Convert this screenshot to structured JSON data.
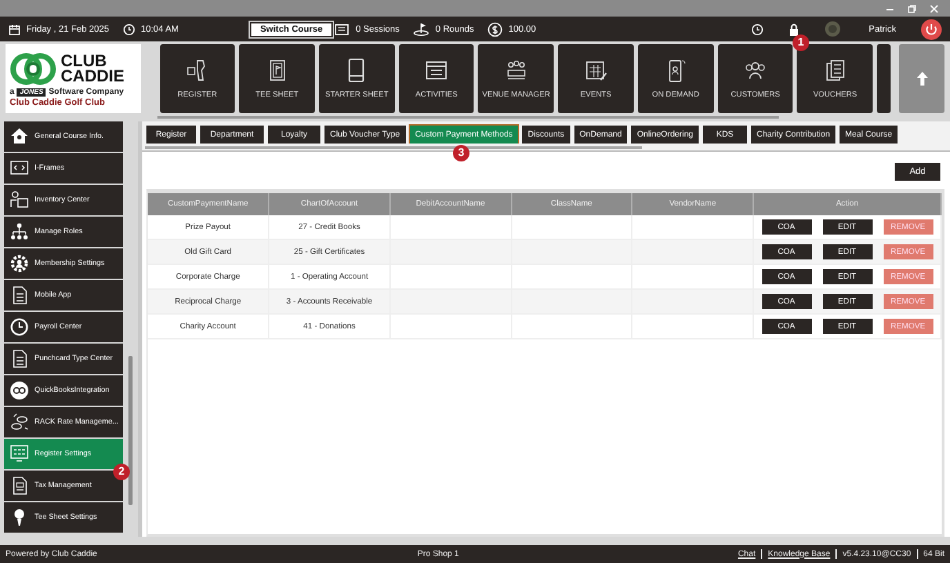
{
  "top_bar": {
    "date": "Friday ,  21 Feb 2025",
    "time": "10:04 AM",
    "switch_course": "Switch Course",
    "sessions": "0 Sessions",
    "rounds": "0 Rounds",
    "balance": "100.00",
    "user": "Patrick"
  },
  "logo": {
    "line1": "CLUB",
    "line2": "CADDIE",
    "prefix": "a",
    "brand": "JONES",
    "rest": "Software Company",
    "club_name": "Club Caddie Golf Club"
  },
  "modules": [
    {
      "label": "REGISTER"
    },
    {
      "label": "TEE SHEET"
    },
    {
      "label": "STARTER SHEET"
    },
    {
      "label": "ACTIVITIES"
    },
    {
      "label": "VENUE MANAGER"
    },
    {
      "label": "EVENTS"
    },
    {
      "label": "ON DEMAND"
    },
    {
      "label": "CUSTOMERS"
    },
    {
      "label": "VOUCHERS"
    }
  ],
  "sidebar": {
    "items": [
      {
        "label": "General Course Info.",
        "selected": false
      },
      {
        "label": "I-Frames",
        "selected": false
      },
      {
        "label": "Inventory Center",
        "selected": false
      },
      {
        "label": "Manage Roles",
        "selected": false
      },
      {
        "label": "Membership Settings",
        "selected": false
      },
      {
        "label": "Mobile App",
        "selected": false
      },
      {
        "label": "Payroll Center",
        "selected": false
      },
      {
        "label": "Punchcard Type Center",
        "selected": false
      },
      {
        "label": "QuickBooksIntegration",
        "selected": false
      },
      {
        "label": "RACK Rate Manageme...",
        "selected": false
      },
      {
        "label": "Register Settings",
        "selected": true
      },
      {
        "label": "Tax Management",
        "selected": false
      },
      {
        "label": "Tee Sheet Settings",
        "selected": false
      }
    ]
  },
  "tabs": [
    {
      "label": "Register",
      "selected": false
    },
    {
      "label": "Department",
      "selected": false
    },
    {
      "label": "Loyalty",
      "selected": false
    },
    {
      "label": "Club Voucher Type",
      "selected": false
    },
    {
      "label": "Custom Payment Methods",
      "selected": true
    },
    {
      "label": "Discounts",
      "selected": false
    },
    {
      "label": "OnDemand",
      "selected": false
    },
    {
      "label": "OnlineOrdering",
      "selected": false
    },
    {
      "label": "KDS",
      "selected": false
    },
    {
      "label": "Charity Contribution",
      "selected": false
    },
    {
      "label": "Meal Course",
      "selected": false
    }
  ],
  "add_button": "Add",
  "table": {
    "columns": [
      "CustomPaymentName",
      "ChartOfAccount",
      "DebitAccountName",
      "ClassName",
      "VendorName",
      "Action"
    ],
    "rows": [
      {
        "cells": [
          "Prize Payout",
          "27 - Credit Books",
          "",
          "",
          ""
        ],
        "actions": [
          "COA",
          "EDIT",
          "REMOVE"
        ]
      },
      {
        "cells": [
          "Old Gift Card",
          "25 - Gift Certificates",
          "",
          "",
          ""
        ],
        "actions": [
          "COA",
          "EDIT",
          "REMOVE"
        ]
      },
      {
        "cells": [
          "Corporate Charge",
          "1 - Operating Account",
          "",
          "",
          ""
        ],
        "actions": [
          "COA",
          "EDIT",
          "REMOVE"
        ]
      },
      {
        "cells": [
          "Reciprocal Charge",
          "3 - Accounts Receivable",
          "",
          "",
          ""
        ],
        "actions": [
          "COA",
          "EDIT",
          "REMOVE"
        ]
      },
      {
        "cells": [
          "Charity Account",
          "41 - Donations",
          "",
          "",
          ""
        ],
        "actions": [
          "COA",
          "EDIT",
          "REMOVE"
        ]
      }
    ]
  },
  "annotations": [
    {
      "number": "1"
    },
    {
      "number": "2"
    },
    {
      "number": "3"
    }
  ],
  "status_bar": {
    "left": "Powered by Club Caddie",
    "center": "Pro Shop 1",
    "links": [
      "Chat",
      "Knowledge Base"
    ],
    "version": "v5.4.23.10@CC30",
    "bits": "64 Bit"
  }
}
